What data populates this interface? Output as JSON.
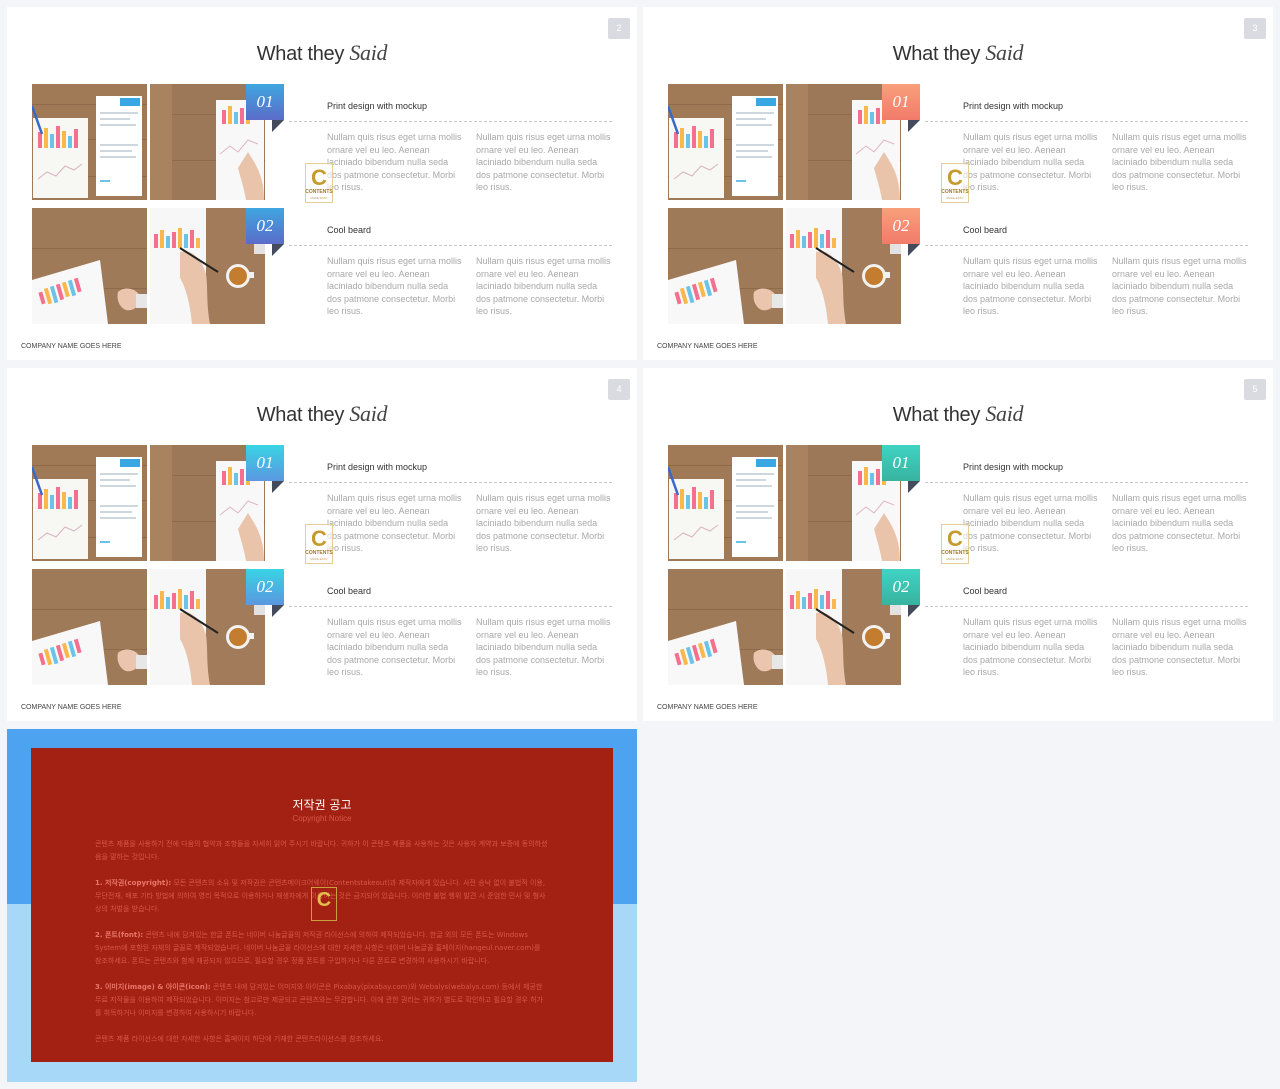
{
  "slides": [
    {
      "id": "s2",
      "theme": "blue",
      "page_number": "2"
    },
    {
      "id": "s3",
      "theme": "orange",
      "page_number": "3"
    },
    {
      "id": "s4",
      "theme": "cyan",
      "page_number": "4"
    },
    {
      "id": "s5",
      "theme": "teal",
      "page_number": "5"
    }
  ],
  "content": {
    "title_plain": "What they ",
    "title_italic": "Said",
    "badge_1": "01",
    "badge_2": "02",
    "section_1_title": "Print design with mockup",
    "section_2_title": "Cool beard",
    "paragraph": "Nullam quis risus eget urna mollis ornare vel eu leo. Aenean laciniado bibendum nulla seda dos patmone consectetur. Morbi leo risus.",
    "footer": "COMPANY NAME GOES HERE",
    "watermark_letter": "C",
    "watermark_text": "CONTENTS",
    "watermark_sub": "MAKE EASY"
  },
  "copyright": {
    "title": "저작권 공고",
    "subtitle": "Copyright Notice",
    "intro": "콘텐츠 제품을 사용하기 전에 다음의 협약과 조항들을 자세히 읽어 주시기 바랍니다. 귀하가 이 콘텐츠 제품을 사용하는 것은 사용자 계약과 보증에 동의하셨음을 말하는 것입니다.",
    "item1_label": "1. 저작권(copyright):",
    "item1_text": " 모든 콘텐츠의 소유 및 저작권은 콘텐츠메이크어웨이(Contentstakeout)과 제작자에게 있습니다. 사전 승낙 없이 불법적 이용, 무단전재, 배포 기타 방법에 의하여 영리 목적으로 이용하거나 재생자에게 이용하는 것은 금지되어 있습니다. 이러한 불법 행위 발견 시 준엄한 민사 및 형사상의 처벌을 받습니다.",
    "item2_label": "2. 폰트(font):",
    "item2_text": " 콘텐츠 내에 담겨있는 한글 폰트는 네이버 나눔글꼴의 저작권 라이선스에 의하여 제작되었습니다. 한글 외의 모든 폰트는 Windows System에 포함된 자체의 글꼴로 제작되었습니다. 네이버 나눔글꼴 라이선스에 대한 자세한 사항은 네이버 나눔글꼴 홈페이지(hangeul.naver.com)를 참조하세요. 폰트는 콘텐츠와 함께 재공되지 않으므로, 필요할 경우 정품 폰트를 구입하거나 다른 폰트로 변경하여 사용하시기 바랍니다.",
    "item3_label": "3. 이미지(image) & 아이콘(icon):",
    "item3_text": " 콘텐츠 내에 담겨있는 이미지와 아이콘은 Pixabay(pixabay.com)와 Webalys(webalys.com) 등에서 제공한 무료 저작물을 이용하여 제작되었습니다. 이미지는 참고로만 제공되고 콘텐츠와는 무관합니다. 이에 관한 권리는 귀하가 별도로 확인하고 필요할 경우 허가를 취득하거나 이미지를 변경하여 사용하시기 바랍니다.",
    "outro": "콘텐츠 제품 라이선스에 대한 자세한 사항은 홈페이지 하단에 기재한 콘텐츠라이선스를 참조하세요."
  }
}
